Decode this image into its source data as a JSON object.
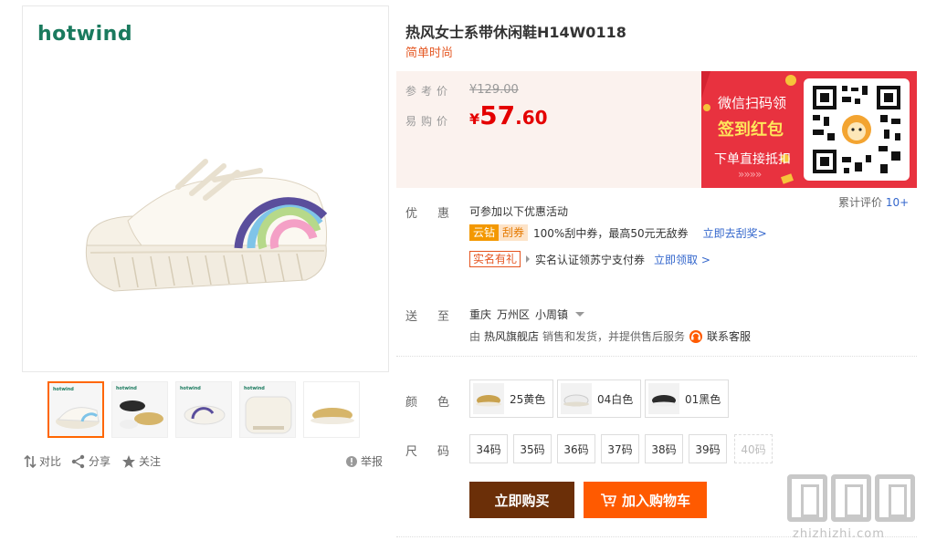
{
  "brand": {
    "logo_text": "hotwind"
  },
  "gallery": {
    "thumbnails": [
      {
        "name": "thumb-1",
        "logo": "hotwind"
      },
      {
        "name": "thumb-2",
        "logo": "hotwind"
      },
      {
        "name": "thumb-3",
        "logo": "hotwind"
      },
      {
        "name": "thumb-4",
        "logo": "hotwind"
      },
      {
        "name": "thumb-5",
        "logo": ""
      }
    ],
    "actions": {
      "compare": "对比",
      "share": "分享",
      "follow": "关注",
      "report": "举报"
    }
  },
  "product": {
    "title": "热风女士系带休闲鞋H14W0118",
    "subtitle": "简单时尚"
  },
  "price": {
    "ref_label": "参考价",
    "ref_value": "¥129.00",
    "current_label": "易购价",
    "currency": "¥",
    "int_part": "57",
    "dec_part": ".60"
  },
  "promo_banner": {
    "line1": "微信扫码领",
    "line2": "签到红包",
    "line3": "下单直接抵扣",
    "arrows": "»»»»"
  },
  "review": {
    "label": "累计评价",
    "count": "10+"
  },
  "discount": {
    "label": "优惠",
    "heading": "可参加以下优惠活动",
    "row1": {
      "tag1": "云钻",
      "tag2": "刮券",
      "text": "100%刮中券，最高50元无敌券",
      "link": "立即去刮奖>"
    },
    "row2": {
      "tag": "实名有礼",
      "text": "实名认证领苏宁支付券",
      "link": "立即领取 >"
    }
  },
  "delivery": {
    "label": "送至",
    "province": "重庆",
    "district": "万州区",
    "town": "小周镇",
    "service_prefix": "由",
    "seller": "热风旗舰店",
    "service_suffix": "销售和发货，并提供售后服务",
    "contact": "联系客服"
  },
  "color": {
    "label": "颜色",
    "options": [
      {
        "label": "25黄色",
        "swatch": "#c9a24e"
      },
      {
        "label": "04白色",
        "swatch": "#ececec"
      },
      {
        "label": "01黑色",
        "swatch": "#2b2b2b"
      }
    ]
  },
  "size": {
    "label": "尺码",
    "options": [
      "34码",
      "35码",
      "36码",
      "37码",
      "38码",
      "39码",
      "40码"
    ],
    "disabled": [
      "40码"
    ]
  },
  "buttons": {
    "buy": "立即购买",
    "cart": "加入购物车"
  },
  "watermark": {
    "text": "zhizhizhi.com"
  },
  "colors": {
    "accent": "#ff5a00",
    "buy": "#6b2f08",
    "price": "#e40000",
    "brand": "#1a7a5e",
    "promo": "#e8323f"
  }
}
